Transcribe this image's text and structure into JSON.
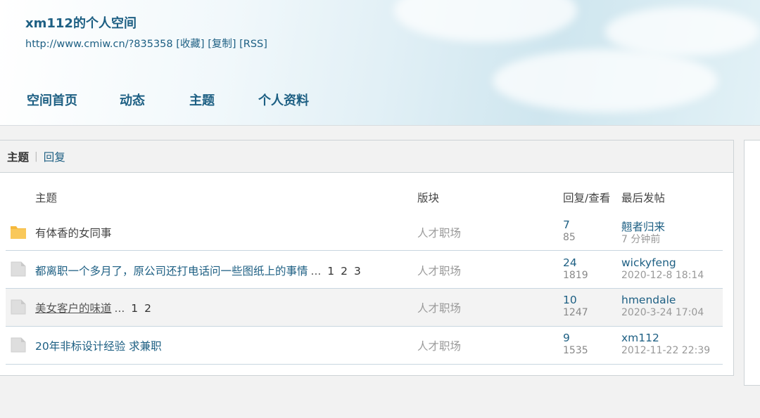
{
  "header": {
    "space_title": "xm112的个人空间",
    "url": "http://www.cmiw.cn/?835358",
    "bookmark": "[收藏]",
    "copy": "[复制]",
    "rss": "[RSS]"
  },
  "nav": [
    {
      "label": "空间首页"
    },
    {
      "label": "动态"
    },
    {
      "label": "主题"
    },
    {
      "label": "个人资料"
    }
  ],
  "tabs": {
    "active": "主题",
    "separator": "|",
    "reply": "回复"
  },
  "table": {
    "headers": {
      "subject": "主题",
      "forum": "版块",
      "stats": "回复/查看",
      "last_post": "最后发帖"
    },
    "rows": [
      {
        "icon": "folder-new-icon",
        "subject": "有体香的女同事",
        "pages": [],
        "forum": "人才职场",
        "replies": "7",
        "views": "85",
        "last_user": "翹者归来",
        "last_time": "7 分钟前"
      },
      {
        "icon": "folder-icon",
        "subject": "都离职一个多月了，原公司还打电话问一些图纸上的事情",
        "ellipsis": "...",
        "pages": [
          "1",
          "2",
          "3"
        ],
        "forum": "人才职场",
        "replies": "24",
        "views": "1819",
        "last_user": "wickyfeng",
        "last_time": "2020-12-8 18:14"
      },
      {
        "icon": "folder-icon",
        "subject": "美女客户的味道",
        "ellipsis": "...",
        "pages": [
          "1",
          "2"
        ],
        "forum": "人才职场",
        "replies": "10",
        "views": "1247",
        "last_user": "hmendale",
        "last_time": "2020-3-24 17:04"
      },
      {
        "icon": "folder-icon",
        "subject": "20年非标设计经验 求兼职",
        "pages": [],
        "forum": "人才职场",
        "replies": "9",
        "views": "1535",
        "last_user": "xm112",
        "last_time": "2012-11-22 22:39"
      }
    ]
  },
  "colors": {
    "link": "#1d5f83",
    "new_folder": "#f6b93b",
    "folder": "#d9d9d9"
  }
}
